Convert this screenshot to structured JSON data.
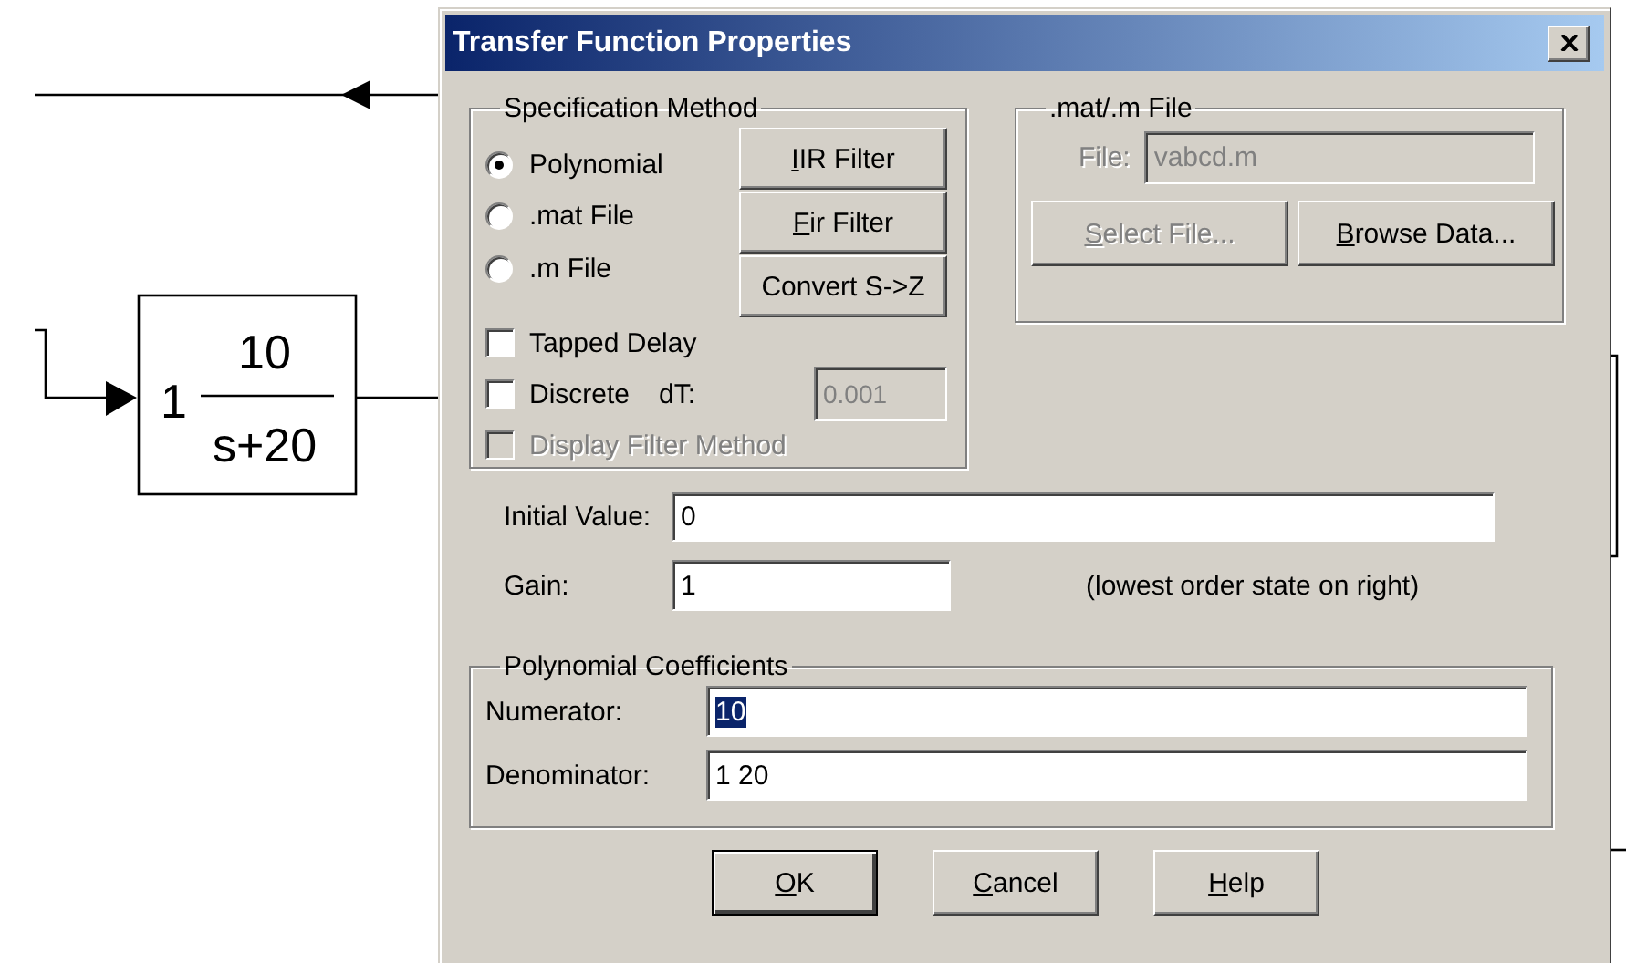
{
  "diagram": {
    "block": {
      "gain": "1",
      "numerator": "10",
      "denominator": "s+20"
    }
  },
  "window": {
    "title": "Transfer Function Properties"
  },
  "specification_method": {
    "title": "Specification Method",
    "options": [
      {
        "label": "Polynomial",
        "selected": true
      },
      {
        "label": ".mat File",
        "selected": false
      },
      {
        "label": ".m File",
        "selected": false
      }
    ],
    "buttons": [
      {
        "mnemonic": "I",
        "label": "IR Filter"
      },
      {
        "mnemonic": "F",
        "label": "ir Filter"
      },
      {
        "label": "Convert S->Z"
      }
    ],
    "checkboxes": [
      {
        "label": "Tapped Delay",
        "checked": false,
        "disabled": false
      },
      {
        "label": "Discrete",
        "checked": false,
        "disabled": false
      },
      {
        "label": "Display Filter Method",
        "checked": false,
        "disabled": true
      }
    ],
    "dt": {
      "label": "dT:",
      "value": "0.001",
      "disabled": true
    }
  },
  "mat_file": {
    "title": ".mat/.m File",
    "file_label": "File:",
    "file_value": "vabcd.m",
    "disabled": true,
    "buttons": [
      {
        "mnemonic": "S",
        "label": "elect File...",
        "disabled": true
      },
      {
        "mnemonic": "B",
        "label": "rowse Data...",
        "disabled": false
      }
    ]
  },
  "initial_value": {
    "label": "Initial Value:",
    "value": "0"
  },
  "gain": {
    "label": "Gain:",
    "value": "1"
  },
  "note": "(lowest order state on right)",
  "polynomial_coefficients": {
    "title": "Polynomial Coefficients",
    "fields": [
      {
        "label": "Numerator:",
        "value": "10",
        "selected": true
      },
      {
        "label": "Denominator:",
        "value": "1 20",
        "selected": false
      }
    ]
  },
  "buttons": [
    {
      "mnemonic": "O",
      "label": "K",
      "default": true
    },
    {
      "mnemonic": "C",
      "label": "ancel",
      "default": false
    },
    {
      "mnemonic": "H",
      "label": "elp",
      "default": false
    }
  ]
}
